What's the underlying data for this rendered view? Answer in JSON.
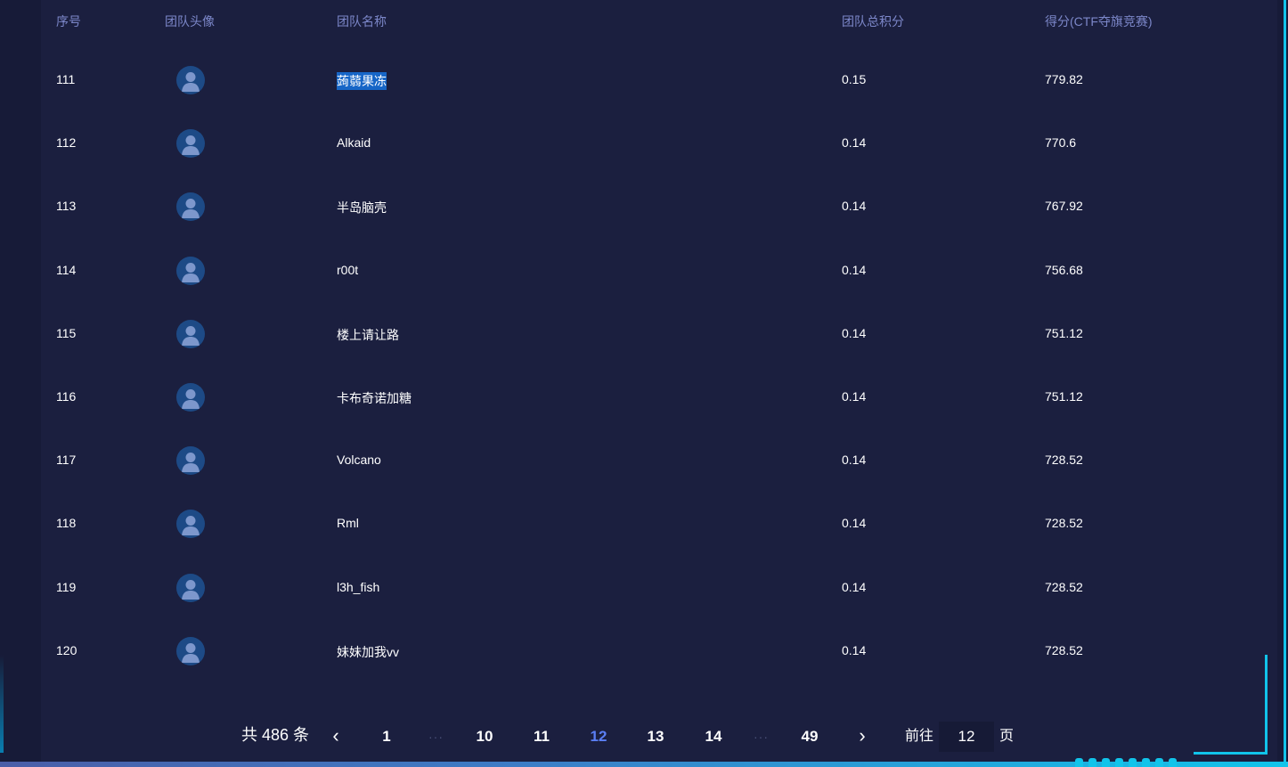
{
  "table": {
    "headers": {
      "rank": "序号",
      "avatar": "团队头像",
      "name": "团队名称",
      "total": "团队总积分",
      "score": "得分(CTF夺旗竞赛)"
    },
    "rows": [
      {
        "rank": "111",
        "name": "蒟蒻果冻",
        "total": "0.15",
        "score": "779.82",
        "selected": true
      },
      {
        "rank": "112",
        "name": "Alkaid",
        "total": "0.14",
        "score": "770.6"
      },
      {
        "rank": "113",
        "name": "半岛脑壳",
        "total": "0.14",
        "score": "767.92"
      },
      {
        "rank": "114",
        "name": "r00t",
        "total": "0.14",
        "score": "756.68"
      },
      {
        "rank": "115",
        "name": "楼上请让路",
        "total": "0.14",
        "score": "751.12"
      },
      {
        "rank": "116",
        "name": "卡布奇诺加糖",
        "total": "0.14",
        "score": "751.12"
      },
      {
        "rank": "117",
        "name": "Volcano",
        "total": "0.14",
        "score": "728.52"
      },
      {
        "rank": "118",
        "name": "Rml",
        "total": "0.14",
        "score": "728.52"
      },
      {
        "rank": "119",
        "name": "l3h_fish",
        "total": "0.14",
        "score": "728.52"
      },
      {
        "rank": "120",
        "name": "妹妹加我vv",
        "total": "0.14",
        "score": "728.52"
      }
    ]
  },
  "pagination": {
    "total": "共 486 条",
    "prev_icon": "chevron-left-icon",
    "next_icon": "chevron-right-icon",
    "pages": [
      "1",
      "10",
      "11",
      "12",
      "13",
      "14",
      "49"
    ],
    "ellipsis": "···",
    "current": "12",
    "goto_label": "前往",
    "goto_value": "12",
    "goto_suffix": "页"
  },
  "colors": {
    "background": "#1b1f3f",
    "header_text": "#7c87c9",
    "active_page": "#5b7ff5",
    "accent": "#11c4ea",
    "selection": "#1766c7"
  }
}
